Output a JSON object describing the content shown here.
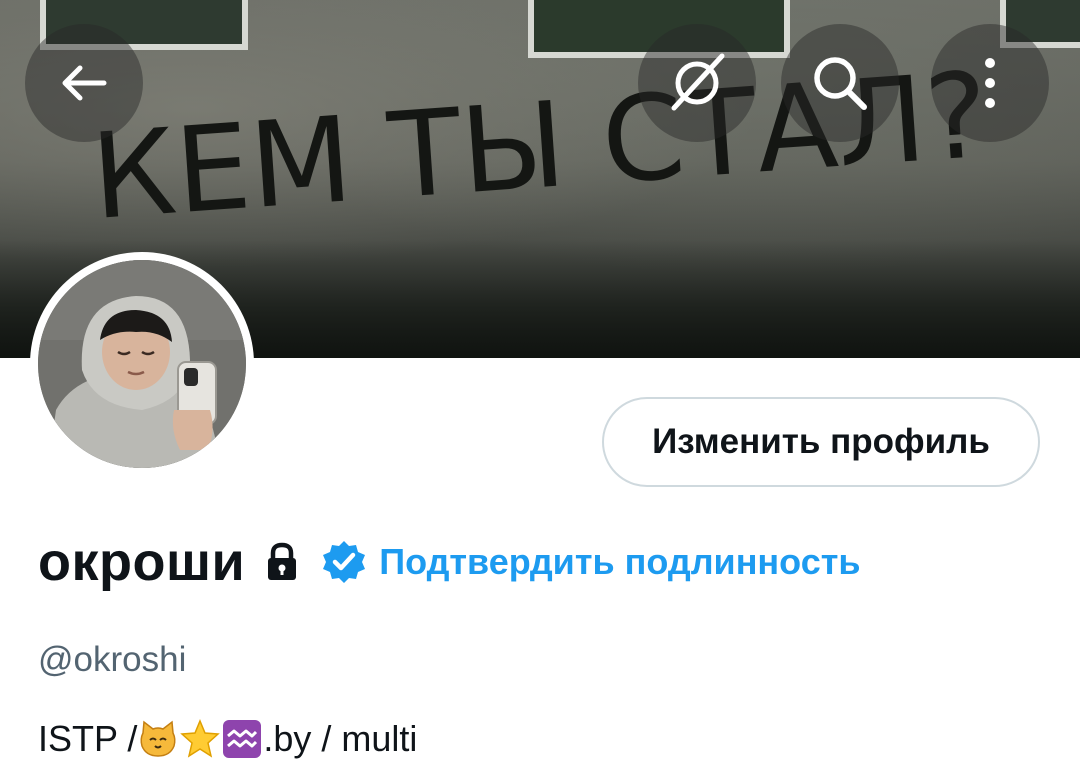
{
  "banner": {
    "graffiti_text": "КЕМ ТЫ СТАЛ?"
  },
  "toolbar": {
    "back_icon": "arrow-left-icon",
    "grok_icon": "grok-slash-icon",
    "search_icon": "search-icon",
    "more_icon": "more-vertical-icon"
  },
  "profile": {
    "edit_button_label": "Изменить профиль",
    "display_name": "окроши",
    "verify_link": "Подтвердить подлинность",
    "handle": "@okroshi",
    "bio_prefix": "ISTP / ",
    "bio_emojis": [
      "cat-face-emoji",
      "star-emoji",
      "aquarius-emoji"
    ],
    "bio_suffix": ".by / multi"
  },
  "colors": {
    "accent": "#1d9bf0",
    "secondary_text": "#536471",
    "border": "#cfd9de"
  }
}
